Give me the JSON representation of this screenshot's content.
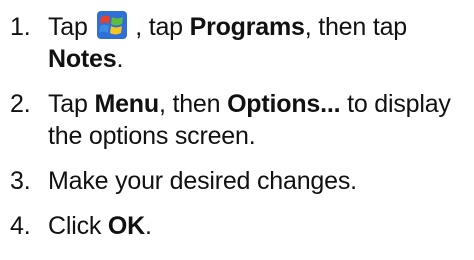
{
  "steps": [
    {
      "number": "1.",
      "text_before_icon": "Tap ",
      "icon": "windows-start-icon",
      "text_after_icon": " , tap ",
      "bold_1": "Programs",
      "text_mid": ", then tap ",
      "bold_2": "Notes",
      "text_end": "."
    },
    {
      "number": "2.",
      "text_before": "Tap ",
      "bold_1": "Menu",
      "text_mid": ", then ",
      "bold_2": "Options...",
      "text_end": " to display the options screen."
    },
    {
      "number": "3.",
      "text": "Make your desired changes."
    },
    {
      "number": "4.",
      "text_before": "Click ",
      "bold_1": "OK",
      "text_end": "."
    }
  ],
  "colors": {
    "text": "#111111",
    "icon_tile": "#2f6fd6",
    "flag_red": "#e8402a",
    "flag_green": "#5bbf3a",
    "flag_blue": "#3a8de0",
    "flag_yellow": "#f6c51f"
  }
}
